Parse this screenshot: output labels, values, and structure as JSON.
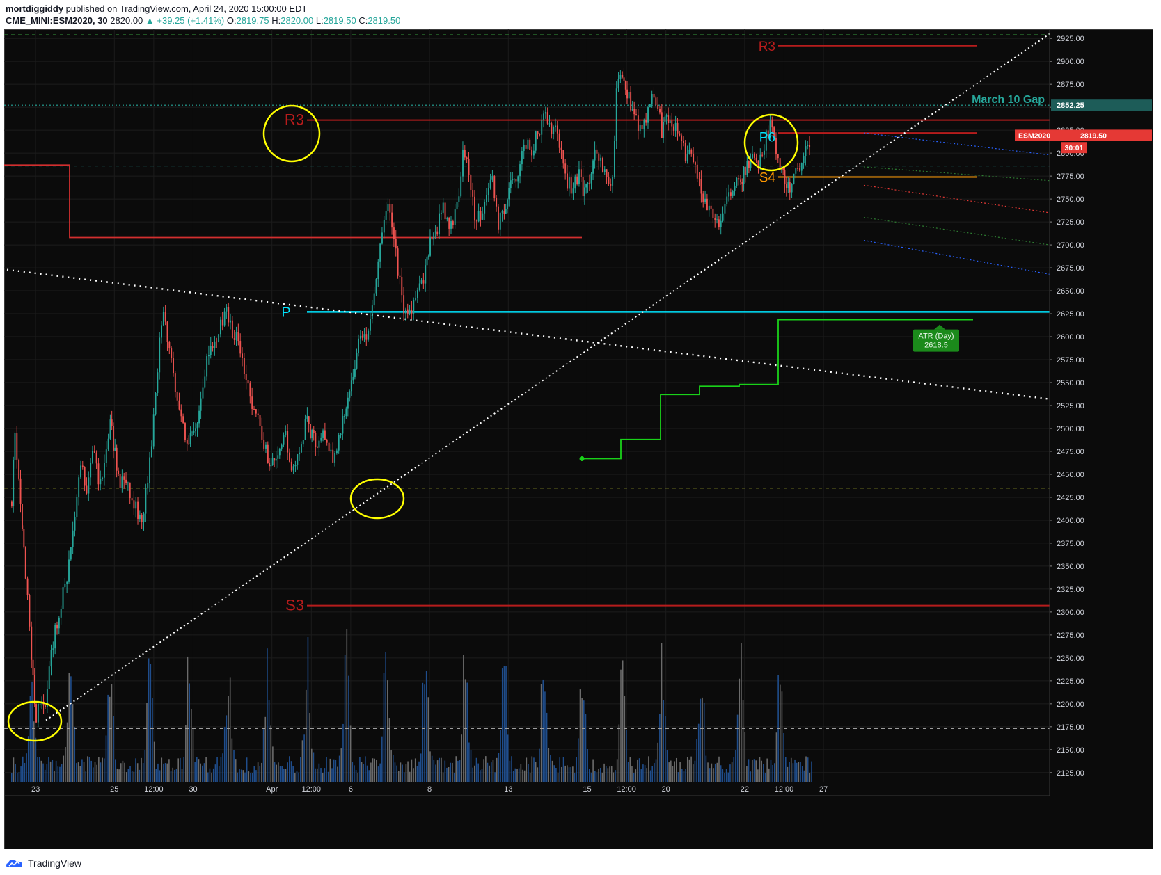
{
  "header": {
    "user": "mortdiggiddy",
    "published": "published on TradingView.com, April 24, 2020 15:00:00 EDT",
    "symbol": "CME_MINI:ESM2020, 30",
    "last": "2820.00",
    "change": "▲ +39.25 (+1.41%)",
    "o_label": "O:",
    "o_val": "2819.75",
    "h_label": "H:",
    "h_val": "2820.00",
    "l_label": "L:",
    "l_val": "2819.50",
    "c_label": "C:",
    "c_val": "2819.50"
  },
  "footer": {
    "brand": "TradingView"
  },
  "colors": {
    "bg": "#0b0b0b",
    "up": "#26a69a",
    "down": "#ef5350",
    "pivot": "#b71c1c",
    "cyan": "#00e5ff",
    "green": "#00ff00",
    "orange": "#ff9800",
    "yellow": "#ffff00"
  },
  "chart_data": {
    "type": "candlestick",
    "symbol": "CME_MINI:ESM2020",
    "interval": "30",
    "ylim": [
      2115,
      2935
    ],
    "y_ticks": [
      2125,
      2150,
      2175,
      2200,
      2225,
      2250,
      2275,
      2300,
      2325,
      2350,
      2375,
      2400,
      2425,
      2450,
      2475,
      2500,
      2525,
      2550,
      2575,
      2600,
      2625,
      2650,
      2675,
      2700,
      2725,
      2750,
      2775,
      2800,
      2825,
      2850,
      2875,
      2900,
      2925
    ],
    "y_tick_labels": [
      "2125.00",
      "2150.00",
      "2175.00",
      "2200.00",
      "2225.00",
      "2250.00",
      "2275.00",
      "2300.00",
      "2325.00",
      "2350.00",
      "2375.00",
      "2400.00",
      "2425.00",
      "2450.00",
      "2475.00",
      "2500.00",
      "2525.00",
      "2550.00",
      "2575.00",
      "2600.00",
      "2625.00",
      "2650.00",
      "2675.00",
      "2700.00",
      "2725.00",
      "2750.00",
      "2775.00",
      "2800.00",
      "2825.00",
      "2850.00",
      "2875.00",
      "2900.00",
      "2925.00"
    ],
    "x_ticks": [
      {
        "label": "23",
        "t": 0.62
      },
      {
        "label": "25",
        "t": 2.62
      },
      {
        "label": "12:00",
        "t": 3.62
      },
      {
        "label": "30",
        "t": 4.62
      },
      {
        "label": "Apr",
        "t": 6.62
      },
      {
        "label": "12:00",
        "t": 7.62
      },
      {
        "label": "6",
        "t": 8.62
      },
      {
        "label": "8",
        "t": 10.62
      },
      {
        "label": "13",
        "t": 12.62
      },
      {
        "label": "15",
        "t": 14.62
      },
      {
        "label": "12:00",
        "t": 15.62
      },
      {
        "label": "20",
        "t": 16.62
      },
      {
        "label": "22",
        "t": 18.62
      },
      {
        "label": "12:00",
        "t": 19.62
      },
      {
        "label": "27",
        "t": 20.62
      }
    ],
    "path_points": [
      [
        0,
        2420
      ],
      [
        0.08,
        2495
      ],
      [
        0.18,
        2450
      ],
      [
        0.35,
        2340
      ],
      [
        0.5,
        2255
      ],
      [
        0.62,
        2180
      ],
      [
        0.72,
        2205
      ],
      [
        0.85,
        2200
      ],
      [
        1.0,
        2255
      ],
      [
        1.15,
        2290
      ],
      [
        1.4,
        2340
      ],
      [
        1.6,
        2400
      ],
      [
        1.75,
        2460
      ],
      [
        1.9,
        2430
      ],
      [
        2.05,
        2480
      ],
      [
        2.2,
        2440
      ],
      [
        2.35,
        2460
      ],
      [
        2.5,
        2510
      ],
      [
        2.62,
        2470
      ],
      [
        2.75,
        2440
      ],
      [
        2.9,
        2445
      ],
      [
        3.1,
        2415
      ],
      [
        3.3,
        2400
      ],
      [
        3.5,
        2460
      ],
      [
        3.7,
        2570
      ],
      [
        3.85,
        2630
      ],
      [
        3.95,
        2590
      ],
      [
        4.1,
        2560
      ],
      [
        4.3,
        2510
      ],
      [
        4.45,
        2480
      ],
      [
        4.62,
        2500
      ],
      [
        4.8,
        2525
      ],
      [
        4.95,
        2570
      ],
      [
        5.1,
        2590
      ],
      [
        5.3,
        2610
      ],
      [
        5.45,
        2625
      ],
      [
        5.6,
        2605
      ],
      [
        5.75,
        2600
      ],
      [
        5.9,
        2565
      ],
      [
        6.1,
        2530
      ],
      [
        6.3,
        2500
      ],
      [
        6.5,
        2470
      ],
      [
        6.62,
        2460
      ],
      [
        6.8,
        2485
      ],
      [
        6.95,
        2490
      ],
      [
        7.1,
        2450
      ],
      [
        7.3,
        2480
      ],
      [
        7.5,
        2510
      ],
      [
        7.62,
        2490
      ],
      [
        7.8,
        2480
      ],
      [
        7.95,
        2495
      ],
      [
        8.05,
        2470
      ],
      [
        8.2,
        2470
      ],
      [
        8.4,
        2510
      ],
      [
        8.62,
        2555
      ],
      [
        8.8,
        2590
      ],
      [
        9.0,
        2600
      ],
      [
        9.2,
        2650
      ],
      [
        9.4,
        2710
      ],
      [
        9.55,
        2740
      ],
      [
        9.7,
        2705
      ],
      [
        9.85,
        2660
      ],
      [
        9.95,
        2630
      ],
      [
        10.1,
        2625
      ],
      [
        10.3,
        2655
      ],
      [
        10.5,
        2670
      ],
      [
        10.62,
        2700
      ],
      [
        10.8,
        2720
      ],
      [
        10.95,
        2745
      ],
      [
        11.1,
        2715
      ],
      [
        11.3,
        2740
      ],
      [
        11.45,
        2795
      ],
      [
        11.6,
        2780
      ],
      [
        11.75,
        2735
      ],
      [
        11.9,
        2730
      ],
      [
        12.05,
        2755
      ],
      [
        12.2,
        2770
      ],
      [
        12.35,
        2720
      ],
      [
        12.5,
        2740
      ],
      [
        12.62,
        2760
      ],
      [
        12.8,
        2775
      ],
      [
        13.0,
        2810
      ],
      [
        13.2,
        2805
      ],
      [
        13.4,
        2825
      ],
      [
        13.55,
        2840
      ],
      [
        13.7,
        2830
      ],
      [
        13.85,
        2825
      ],
      [
        13.95,
        2795
      ],
      [
        14.1,
        2770
      ],
      [
        14.25,
        2760
      ],
      [
        14.4,
        2780
      ],
      [
        14.5,
        2760
      ],
      [
        14.62,
        2765
      ],
      [
        14.8,
        2805
      ],
      [
        14.95,
        2795
      ],
      [
        15.1,
        2770
      ],
      [
        15.25,
        2765
      ],
      [
        15.35,
        2870
      ],
      [
        15.5,
        2880
      ],
      [
        15.62,
        2865
      ],
      [
        15.8,
        2845
      ],
      [
        15.95,
        2825
      ],
      [
        16.1,
        2835
      ],
      [
        16.25,
        2860
      ],
      [
        16.4,
        2850
      ],
      [
        16.5,
        2825
      ],
      [
        16.62,
        2840
      ],
      [
        16.8,
        2830
      ],
      [
        16.95,
        2820
      ],
      [
        17.1,
        2800
      ],
      [
        17.3,
        2790
      ],
      [
        17.5,
        2760
      ],
      [
        17.7,
        2735
      ],
      [
        17.85,
        2725
      ],
      [
        18.0,
        2725
      ],
      [
        18.2,
        2750
      ],
      [
        18.35,
        2770
      ],
      [
        18.5,
        2770
      ],
      [
        18.62,
        2780
      ],
      [
        18.8,
        2800
      ],
      [
        18.95,
        2780
      ],
      [
        19.1,
        2810
      ],
      [
        19.25,
        2830
      ],
      [
        19.4,
        2805
      ],
      [
        19.5,
        2790
      ],
      [
        19.62,
        2770
      ],
      [
        19.75,
        2760
      ],
      [
        19.9,
        2790
      ],
      [
        20.0,
        2775
      ],
      [
        20.1,
        2800
      ],
      [
        20.2,
        2812
      ],
      [
        20.3,
        2819.5
      ]
    ],
    "volume_note": "Volume histogram shown at bottom of price pane",
    "annotations": [
      {
        "kind": "label",
        "text": "R3",
        "t": 6.62,
        "y": 2836,
        "color": "#b71c1c"
      },
      {
        "kind": "label",
        "text": "S3",
        "t": 6.62,
        "y": 2307,
        "color": "#b71c1c"
      },
      {
        "kind": "label",
        "text": "P",
        "t": 6.57,
        "y": 2627,
        "color": "#00e5ff"
      },
      {
        "kind": "label",
        "text": "R3",
        "t": 18.1,
        "y": 2917,
        "color": "#b71c1c"
      },
      {
        "kind": "label",
        "text": "S4",
        "t": 18.1,
        "y": 2774,
        "color": "#ff9800"
      },
      {
        "kind": "label",
        "text": "P6",
        "t": 18.1,
        "y": 2818,
        "color": "#00e5ff"
      },
      {
        "kind": "label",
        "text": "March 10 Gap",
        "t": 22.6,
        "y": 2860,
        "color": "#26a69a"
      }
    ],
    "price_labels": [
      {
        "text": "2852.25",
        "y": 2852.25,
        "bg": "#1d5c58",
        "fg": "#ffffff"
      },
      {
        "text": "ESM2020",
        "value": "2819.50",
        "y": 2819.5,
        "bg": "#e53935",
        "fg": "#ffffff"
      },
      {
        "text": "30:01",
        "y": 2806,
        "bg": "#e53935",
        "fg": "#ffffff"
      }
    ],
    "atr_box": {
      "title": "ATR (Day)",
      "value": "2618.5",
      "t": 21.9,
      "y": 2618.5,
      "color": "#1b8a1b"
    }
  }
}
